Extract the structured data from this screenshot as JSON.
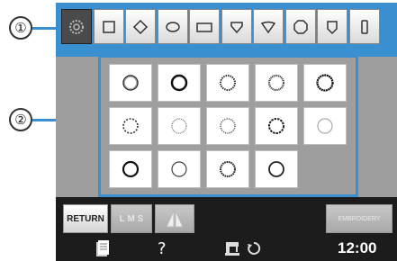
{
  "callouts": {
    "one": "①",
    "two": "②"
  },
  "colors": {
    "accent": "#3a8fd1",
    "panel": "#9e9e9e",
    "bar": "#1c1c1c"
  },
  "tabs": [
    {
      "icon": "stitch-pattern-icon",
      "active": true
    },
    {
      "icon": "square-shape-icon"
    },
    {
      "icon": "diamond-shape-icon"
    },
    {
      "icon": "oval-shape-icon"
    },
    {
      "icon": "rectangle-shape-icon"
    },
    {
      "icon": "shield-shape-icon"
    },
    {
      "icon": "heart-shape-icon"
    },
    {
      "icon": "octagon-shape-icon"
    },
    {
      "icon": "badge-shape-icon"
    },
    {
      "icon": "narrow-rectangle-icon"
    }
  ],
  "frame_styles": [
    {
      "icon": "circle-thin-icon"
    },
    {
      "icon": "circle-bold-icon"
    },
    {
      "icon": "circle-zigzag-icon"
    },
    {
      "icon": "circle-beaded-icon"
    },
    {
      "icon": "circle-double-icon"
    },
    {
      "icon": "circle-dashed-icon"
    },
    {
      "icon": "circle-dotted-icon"
    },
    {
      "icon": "circle-scalloped-icon"
    },
    {
      "icon": "circle-wavy-icon"
    },
    {
      "icon": "circle-light-icon"
    },
    {
      "icon": "circle-heavy-icon"
    },
    {
      "icon": "circle-fine-icon"
    },
    {
      "icon": "circle-stippled-icon"
    },
    {
      "icon": "circle-outline-icon"
    }
  ],
  "buttons": {
    "return_label": "RETURN",
    "size_label": "L M S",
    "embroidery_label": "EMBROIDERY"
  },
  "status": {
    "help_label": "?",
    "clock": "12:00"
  }
}
